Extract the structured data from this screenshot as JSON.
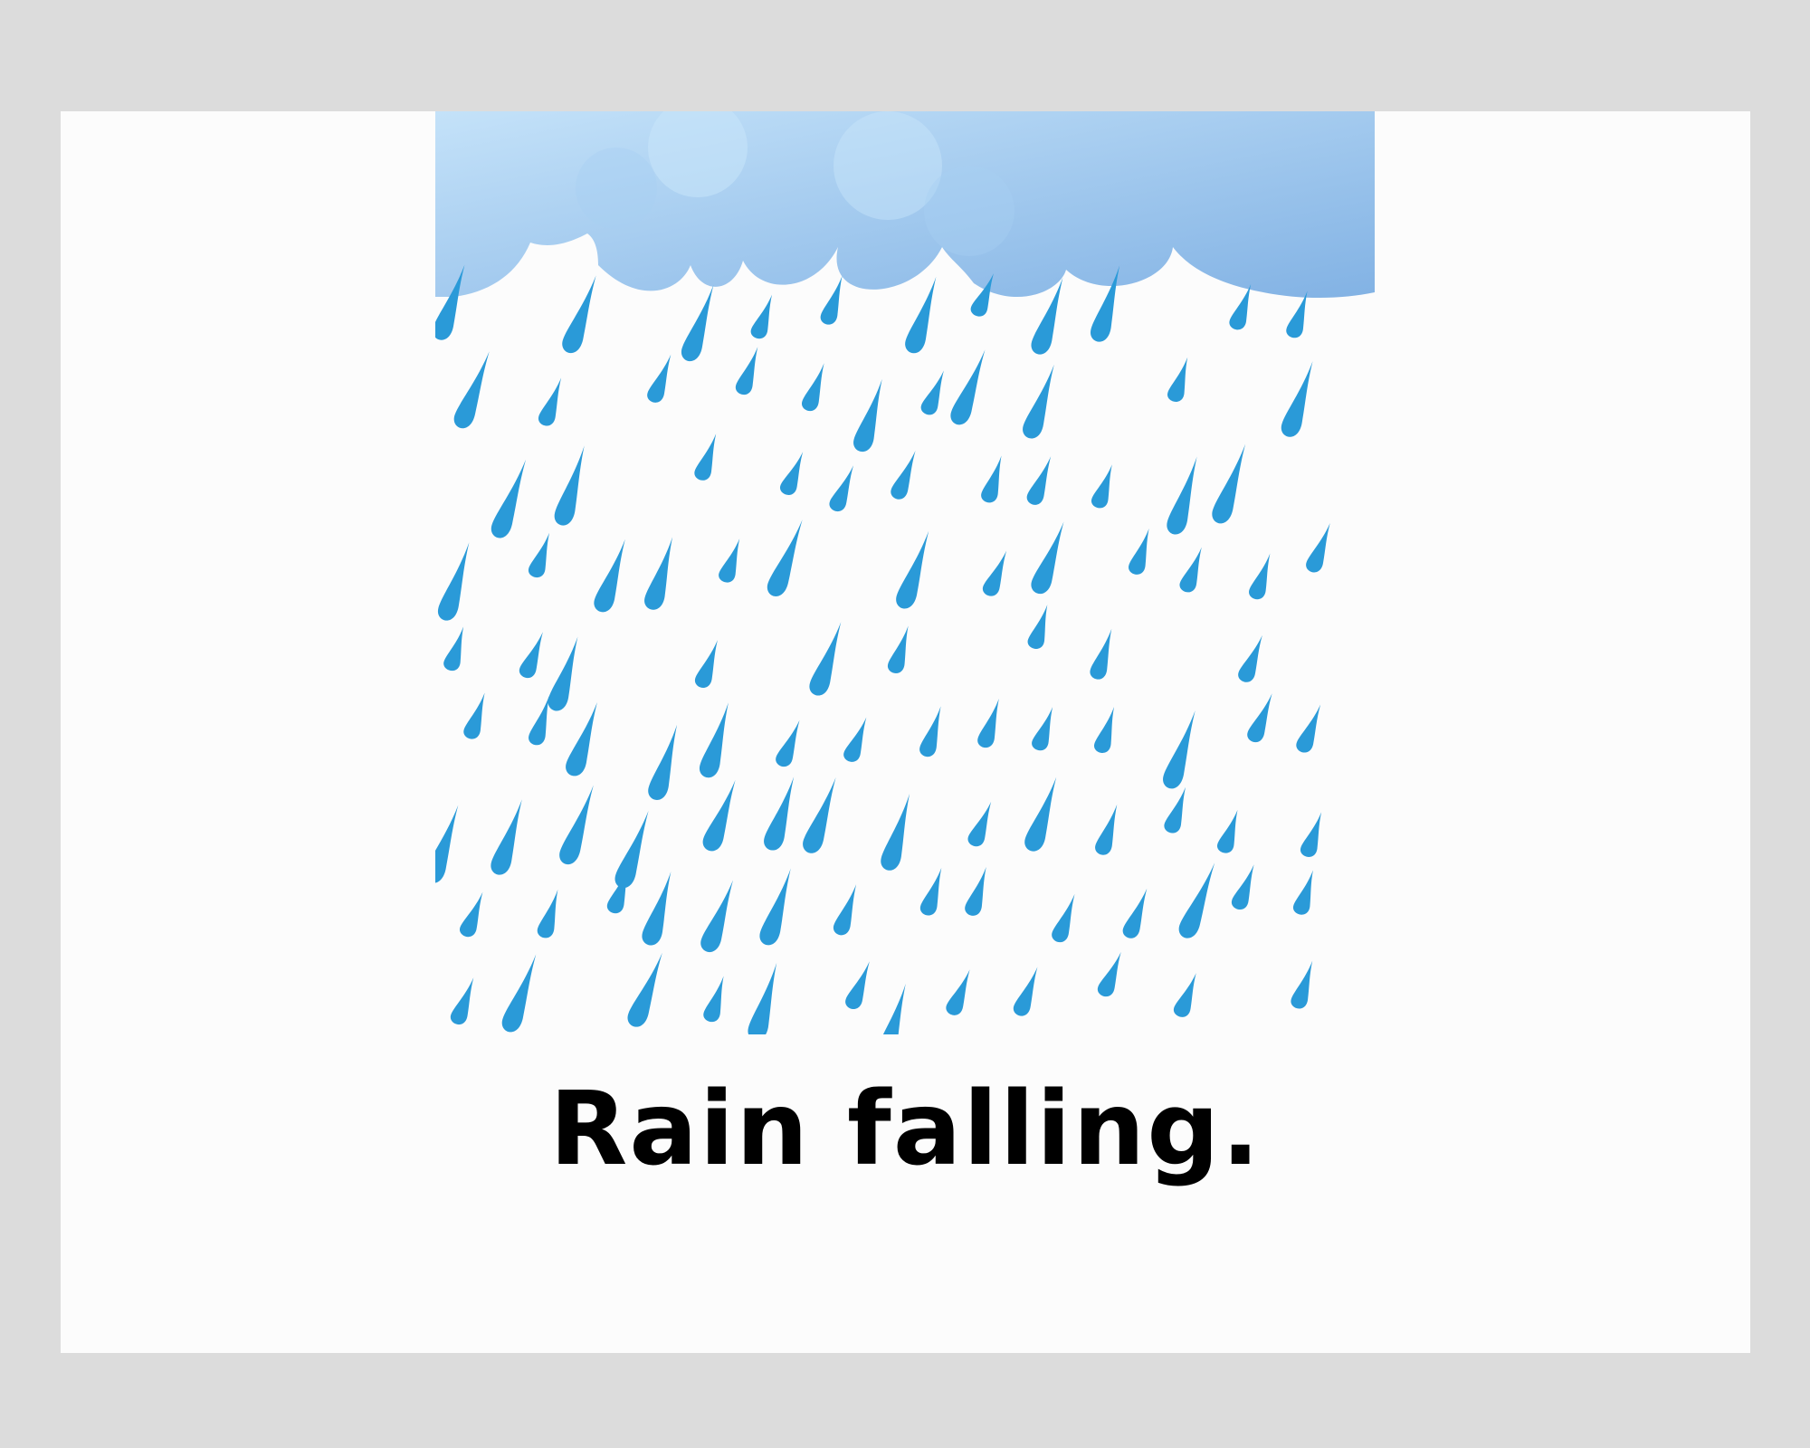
{
  "caption": "Rain falling.",
  "scene": {
    "cloud_icon": "cloud-icon",
    "raindrop_icon": "raindrop-icon",
    "colors": {
      "background": "#dcdcdc",
      "page": "#fcfcfc",
      "cloud_light": "#bfe0f8",
      "cloud_dark": "#86b6e6",
      "raindrop": "#2a9ad8",
      "caption": "#000000"
    }
  }
}
